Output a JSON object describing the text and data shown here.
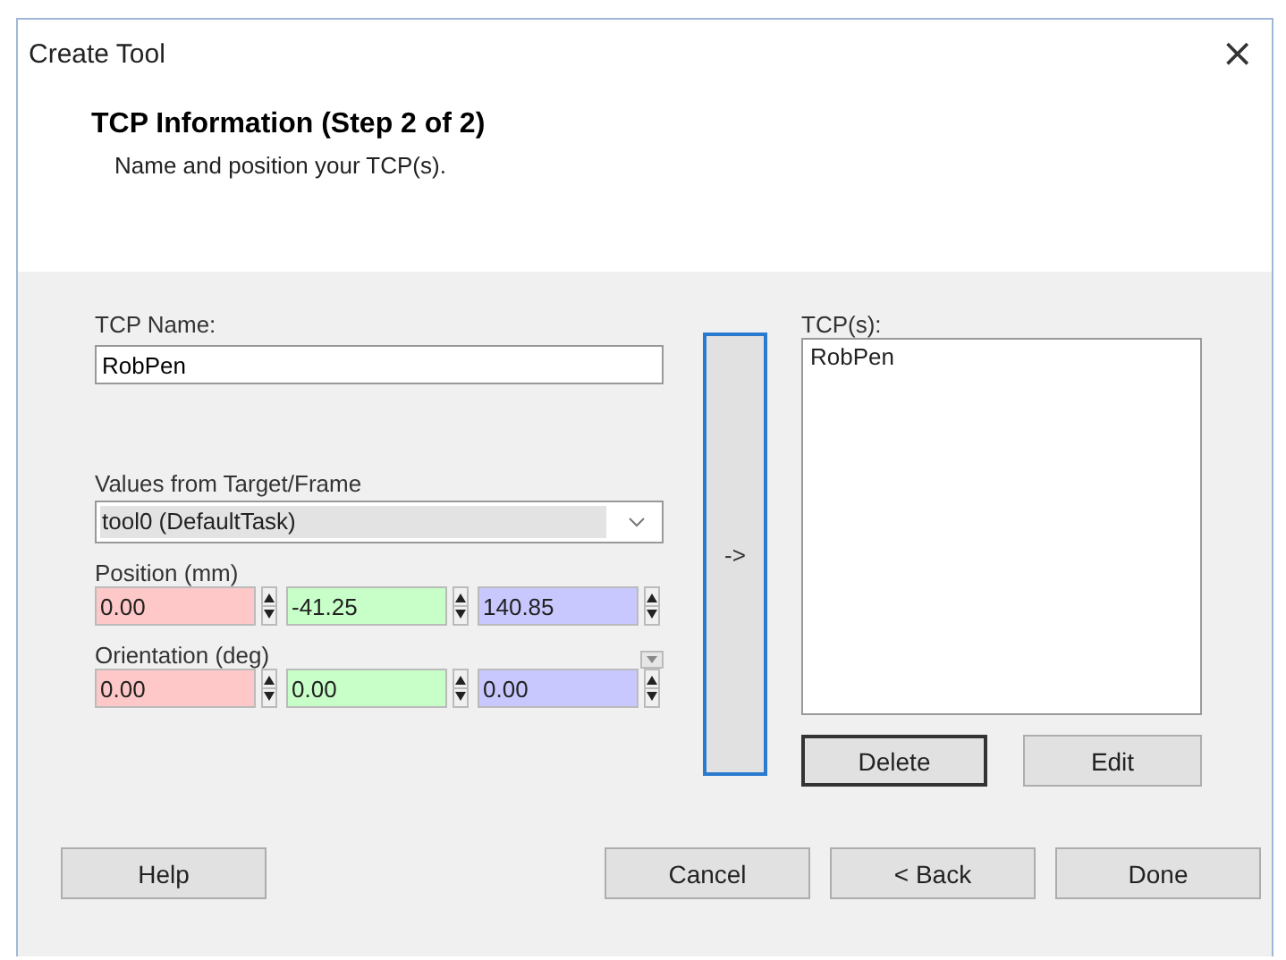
{
  "window": {
    "title": "Create Tool",
    "close": "×"
  },
  "header": {
    "title": "TCP Information (Step 2 of 2)",
    "subtitle": "Name and position your TCP(s)."
  },
  "tcp_name": {
    "label": "TCP Name:",
    "value": "RobPen"
  },
  "values_from": {
    "label": "Values from Target/Frame",
    "value": "tool0 (DefaultTask)"
  },
  "position": {
    "label": "Position (mm)",
    "fields": [
      {
        "value": "0.00",
        "color": "#ffc8c8"
      },
      {
        "value": "-41.25",
        "color": "#c8ffc8"
      },
      {
        "value": "140.85",
        "color": "#c8c8ff"
      }
    ]
  },
  "orientation": {
    "label": "Orientation (deg)",
    "fields": [
      {
        "value": "0.00",
        "color": "#ffc8c8"
      },
      {
        "value": "0.00",
        "color": "#c8ffc8"
      },
      {
        "value": "0.00",
        "color": "#c8c8ff"
      }
    ]
  },
  "add_button": "->",
  "tcp_list": {
    "label": "TCP(s):",
    "items": [
      "RobPen"
    ]
  },
  "list_buttons": [
    {
      "label": "Delete",
      "focused": true
    },
    {
      "label": "Edit",
      "focused": false
    }
  ],
  "footer_buttons": [
    {
      "label": "Help"
    },
    {
      "label": "Cancel"
    },
    {
      "label": "< Back"
    },
    {
      "label": "Done"
    }
  ]
}
